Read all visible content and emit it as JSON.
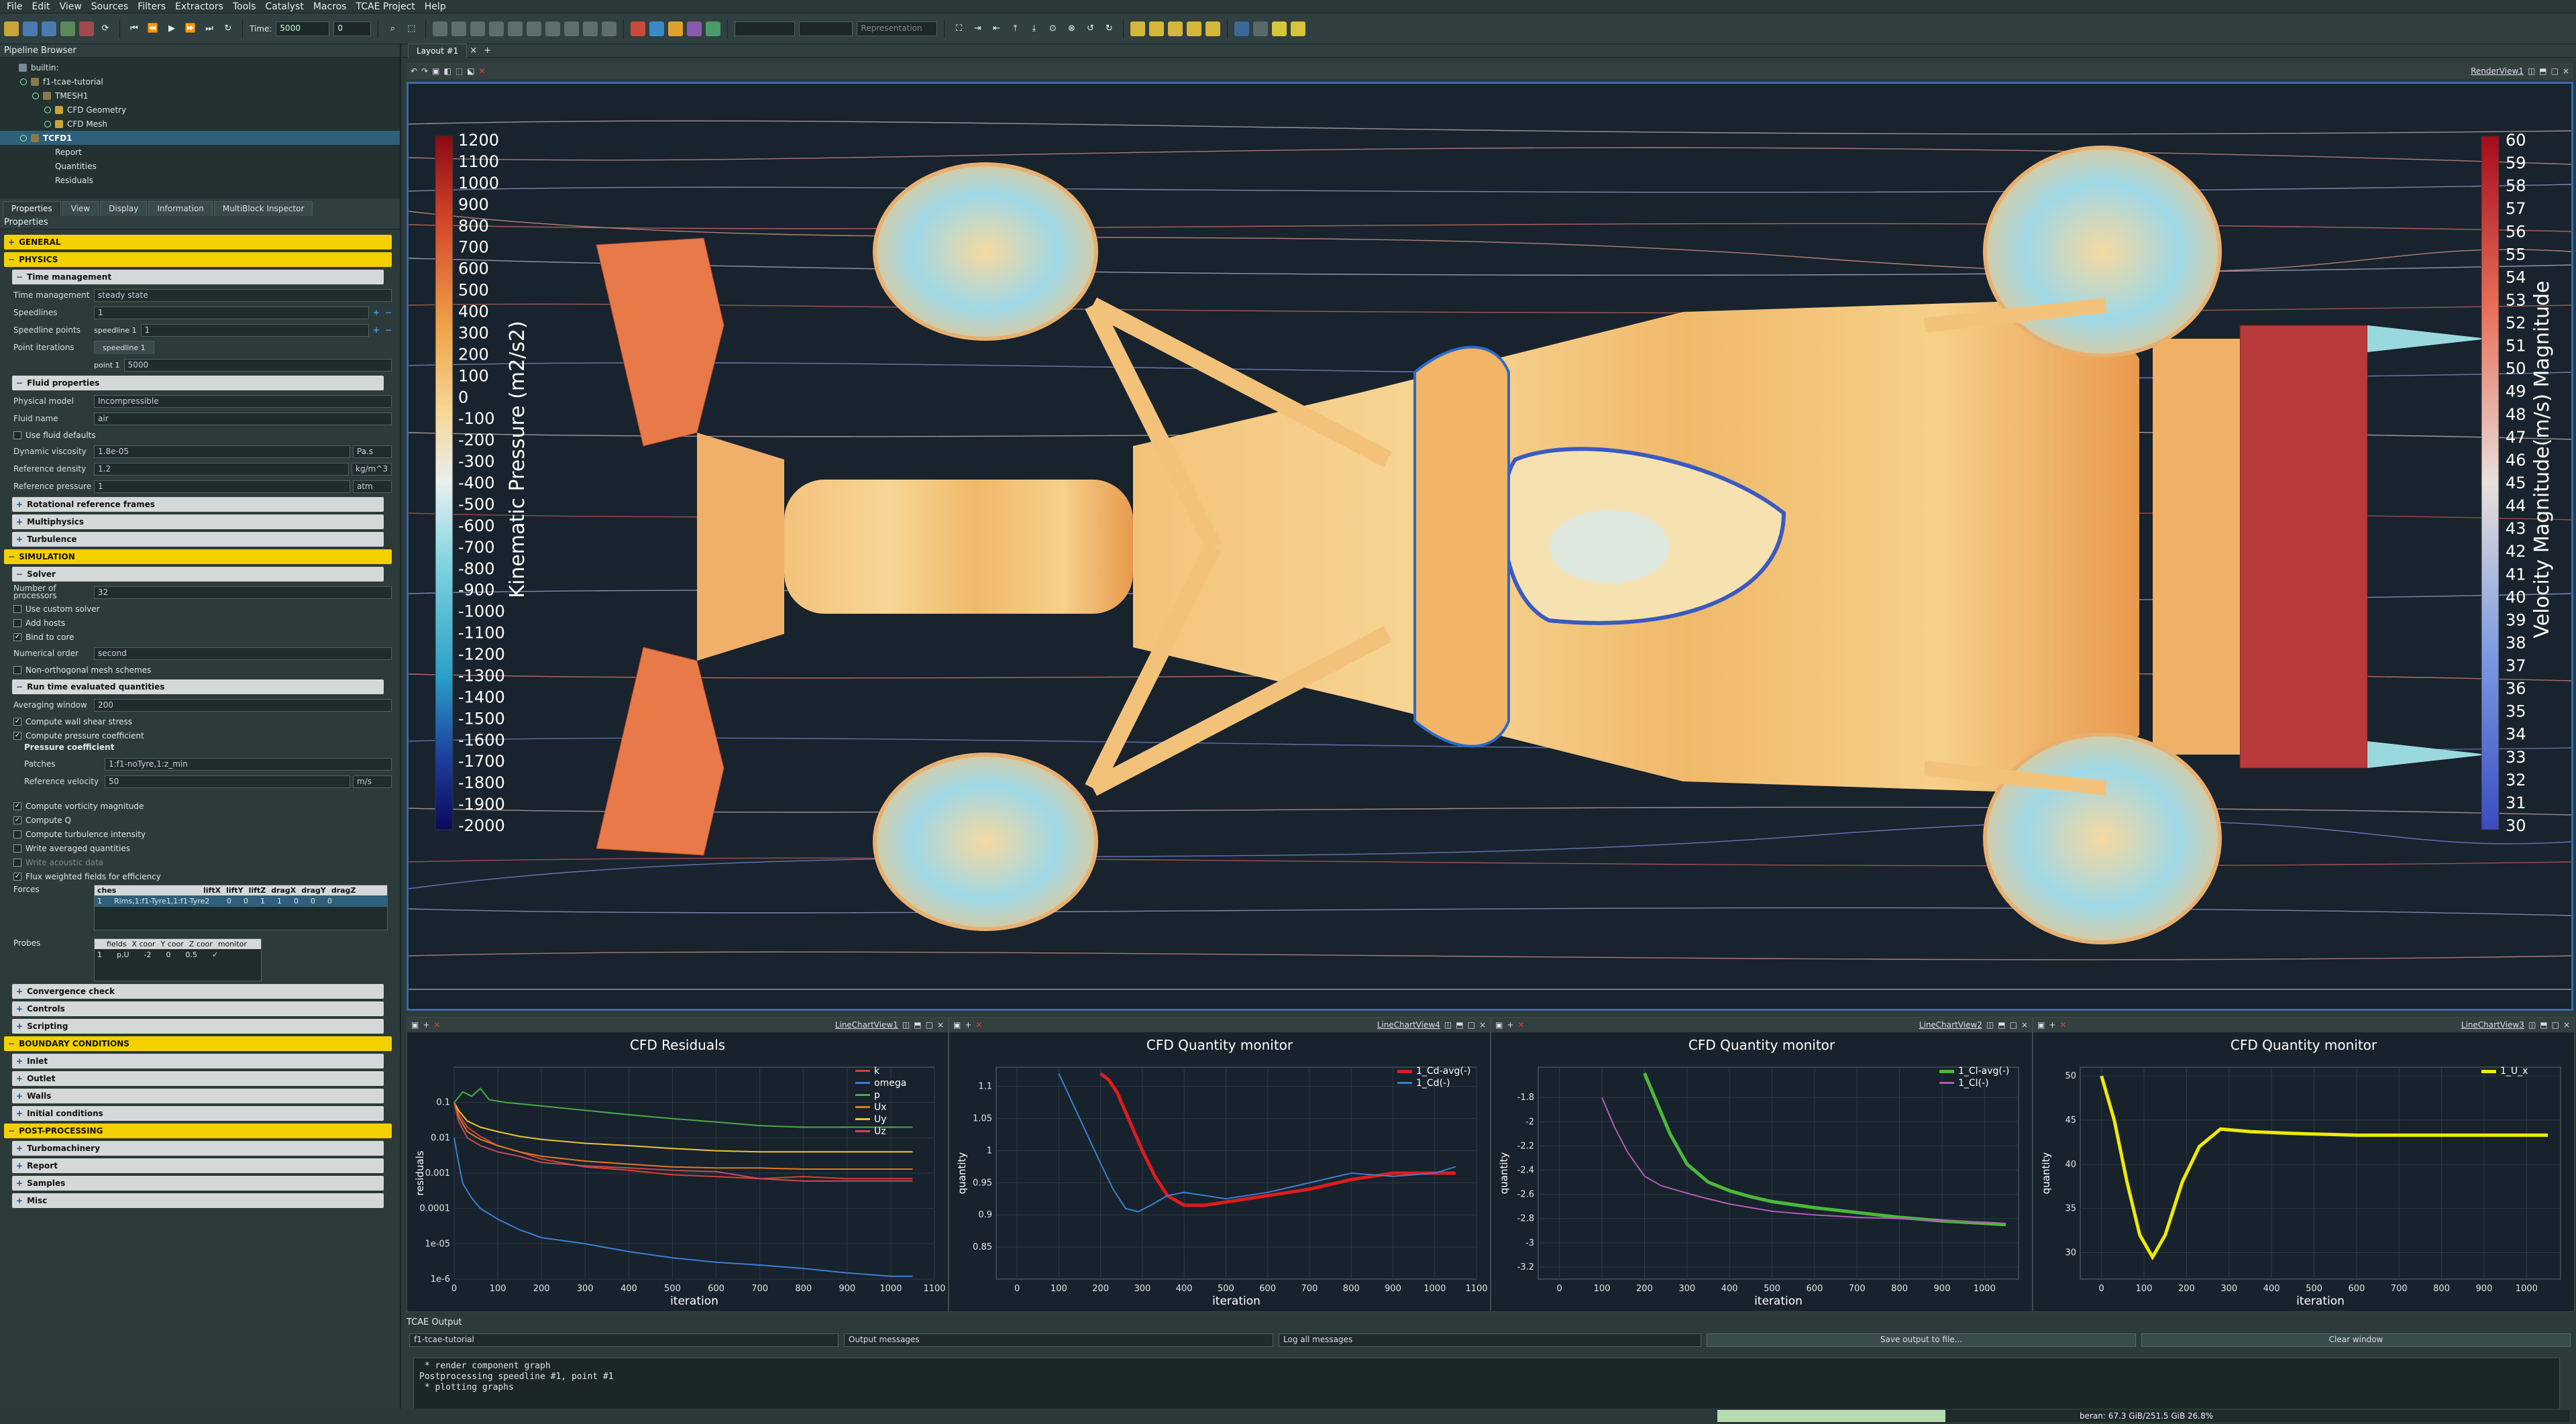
{
  "menu": [
    "File",
    "Edit",
    "View",
    "Sources",
    "Filters",
    "Extractors",
    "Tools",
    "Catalyst",
    "Macros",
    "TCAE Project",
    "Help"
  ],
  "toolbar": {
    "time_label": "Time:",
    "time_value": "5000",
    "time_index": "0",
    "representation": "Representation"
  },
  "pipeline": {
    "title": "Pipeline Browser",
    "items": [
      "builtin:",
      "f1-tcae-tutorial",
      "TMESH1",
      "CFD Geometry",
      "CFD Mesh",
      "TCFD1",
      "Report",
      "Quantities",
      "Residuals"
    ]
  },
  "tabs": [
    "Properties",
    "View",
    "Display",
    "Information",
    "MultiBlock Inspector"
  ],
  "props_title": "Properties",
  "sections": {
    "general": "GENERAL",
    "physics": "PHYSICS",
    "simulation": "SIMULATION",
    "boundary": "BOUNDARY CONDITIONS",
    "post": "POST-PROCESSING"
  },
  "time_mgmt": {
    "title": "Time management",
    "label": "Time management",
    "value": "steady state",
    "speedlines_label": "Speedlines",
    "speedlines_value": "1",
    "points_label": "Speedline points",
    "points_sub": "speedline 1",
    "points_value": "1",
    "iter_label": "Point iterations",
    "iter_tab": "speedline 1",
    "iter_point": "point 1",
    "iter_value": "5000"
  },
  "fluid": {
    "title": "Fluid properties",
    "model_label": "Physical model",
    "model_value": "Incompressible",
    "name_label": "Fluid name",
    "name_value": "air",
    "defaults": "Use fluid defaults",
    "visc_label": "Dynamic viscosity",
    "visc_value": "1.8e-05",
    "visc_unit": "Pa.s",
    "dens_label": "Reference density",
    "dens_value": "1.2",
    "dens_unit": "kg/m^3",
    "pres_label": "Reference pressure",
    "pres_value": "1",
    "pres_unit": "atm"
  },
  "collapsed_phys": [
    "Rotational reference frames",
    "Multiphysics",
    "Turbulence"
  ],
  "solver": {
    "title": "Solver",
    "nproc_label": "Number of processors",
    "nproc_value": "32",
    "custom": "Use custom solver",
    "hosts": "Add hosts",
    "bind": "Bind to core",
    "order_label": "Numerical order",
    "order_value": "second",
    "nonortho": "Non-orthogonal mesh schemes"
  },
  "runtime": {
    "title": "Run time evaluated quantities",
    "avg_label": "Averaging window",
    "avg_value": "200",
    "wss": "Compute wall shear stress",
    "cp": "Compute pressure coefficient",
    "cp_title": "Pressure coefficient",
    "patches_label": "Patches",
    "patches_value": "1:f1-noTyre,1:z_min",
    "vel_label": "Reference velocity",
    "vel_value": "50",
    "vel_unit": "m/s",
    "vort": "Compute vorticity magnitude",
    "q": "Compute Q",
    "ti": "Compute turbulence intensity",
    "avgq": "Write averaged quantities",
    "acoustic": "Write acoustic data",
    "flux": "Flux weighted fields for efficiency",
    "forces_label": "Forces",
    "forces_headers": [
      "ches",
      "liftX",
      "liftY",
      "liftZ",
      "dragX",
      "dragY",
      "dragZ"
    ],
    "forces_row": [
      "1",
      "Rims,1:f1-Tyre1,1:f1-Tyre2",
      "0",
      "0",
      "1",
      "1",
      "0",
      "0",
      "0"
    ],
    "probes_label": "Probes",
    "probes_headers": [
      "fields",
      "X coor",
      "Y coor",
      "Z coor",
      "monitor"
    ],
    "probes_row": [
      "1",
      "p,U",
      "-2",
      "0",
      "0.5",
      "✓"
    ]
  },
  "collapsed_sim": [
    "Convergence check",
    "Controls",
    "Scripting"
  ],
  "collapsed_bc": [
    "Inlet",
    "Outlet",
    "Walls",
    "Initial conditions"
  ],
  "collapsed_post": [
    "Turbomachinery",
    "Report",
    "Samples",
    "Misc"
  ],
  "layout_tab": "Layout #1",
  "render_view": "RenderView1",
  "colorbar_left": {
    "title": "Kinematic Pressure (m2/s2)",
    "ticks": [
      "1200",
      "1100",
      "1000",
      "900",
      "800",
      "700",
      "600",
      "500",
      "400",
      "300",
      "200",
      "100",
      "0",
      "-100",
      "-200",
      "-300",
      "-400",
      "-500",
      "-600",
      "-700",
      "-800",
      "-900",
      "-1000",
      "-1100",
      "-1200",
      "-1300",
      "-1400",
      "-1500",
      "-1600",
      "-1700",
      "-1800",
      "-1900",
      "-2000"
    ]
  },
  "colorbar_right": {
    "title": "Velocity Magnitude(m/s) Magnitude",
    "ticks": [
      "60",
      "59",
      "58",
      "57",
      "56",
      "55",
      "54",
      "53",
      "52",
      "51",
      "50",
      "49",
      "48",
      "47",
      "46",
      "45",
      "44",
      "43",
      "42",
      "41",
      "40",
      "39",
      "38",
      "37",
      "36",
      "35",
      "34",
      "33",
      "32",
      "31",
      "30"
    ]
  },
  "colors": {
    "accent_yellow": "#f5d000",
    "render_border": "#3a6aa8",
    "cd_avg": "#dd1c1c",
    "cl_avg": "#4cb83a",
    "u_x": "#f0ea00"
  },
  "chart_data": [
    {
      "view": "LineChartView1",
      "type": "line",
      "title": "CFD Residuals",
      "xlabel": "iteration",
      "ylabel": "residuals",
      "ylog": true,
      "xlim": [
        0,
        1100
      ],
      "ylim": [
        1e-06,
        1
      ],
      "xticks": [
        "0",
        "100",
        "200",
        "300",
        "400",
        "500",
        "600",
        "700",
        "800",
        "900",
        "1000",
        "1100"
      ],
      "yticks": [
        "0.1",
        "0.01",
        "0.001",
        "0.0001",
        "1e-05",
        "1e-6"
      ],
      "legend": "top-right",
      "series": [
        {
          "name": "k",
          "color": "#d4432a",
          "x": [
            0,
            10,
            30,
            60,
            100,
            150,
            200,
            300,
            400,
            500,
            600,
            700,
            800,
            900,
            1000,
            1050
          ],
          "y": [
            0.1,
            0.05,
            0.02,
            0.011,
            0.006,
            0.004,
            0.0025,
            0.0015,
            0.0012,
            0.0009,
            0.0008,
            0.0007,
            0.0008,
            0.0007,
            0.0007,
            0.0007
          ]
        },
        {
          "name": "omega",
          "color": "#3a7fd0",
          "x": [
            0,
            10,
            20,
            40,
            60,
            100,
            150,
            200,
            300,
            400,
            500,
            600,
            700,
            800,
            900,
            1000,
            1050
          ],
          "y": [
            0.01,
            0.002,
            0.0005,
            0.0002,
            0.0001,
            5e-05,
            2.5e-05,
            1.5e-05,
            1e-05,
            6e-06,
            4e-06,
            3e-06,
            2.5e-06,
            2e-06,
            1.5e-06,
            1.2e-06,
            1.2e-06
          ]
        },
        {
          "name": "p",
          "color": "#4caa46",
          "x": [
            0,
            20,
            40,
            60,
            80,
            120,
            200,
            300,
            400,
            500,
            600,
            700,
            800,
            900,
            1000,
            1050
          ],
          "y": [
            0.1,
            0.2,
            0.15,
            0.25,
            0.12,
            0.1,
            0.08,
            0.06,
            0.045,
            0.035,
            0.028,
            0.022,
            0.02,
            0.02,
            0.02,
            0.02
          ]
        },
        {
          "name": "Ux",
          "color": "#e07a20",
          "x": [
            0,
            10,
            30,
            60,
            100,
            150,
            200,
            300,
            400,
            500,
            600,
            700,
            800,
            900,
            1000,
            1050
          ],
          "y": [
            0.1,
            0.04,
            0.015,
            0.009,
            0.006,
            0.004,
            0.003,
            0.0022,
            0.0018,
            0.0015,
            0.0014,
            0.0014,
            0.0013,
            0.0013,
            0.0013,
            0.0013
          ]
        },
        {
          "name": "Uy",
          "color": "#f2c22e",
          "x": [
            0,
            10,
            30,
            60,
            100,
            150,
            200,
            300,
            400,
            500,
            600,
            700,
            800,
            900,
            1000,
            1050
          ],
          "y": [
            0.1,
            0.06,
            0.03,
            0.02,
            0.015,
            0.011,
            0.009,
            0.007,
            0.006,
            0.005,
            0.0043,
            0.004,
            0.004,
            0.004,
            0.004,
            0.004
          ]
        },
        {
          "name": "Uz",
          "color": "#c64a5a",
          "x": [
            0,
            10,
            30,
            60,
            100,
            150,
            200,
            300,
            400,
            500,
            600,
            700,
            800,
            900,
            1000,
            1050
          ],
          "y": [
            0.1,
            0.03,
            0.01,
            0.006,
            0.004,
            0.003,
            0.002,
            0.0016,
            0.0014,
            0.0012,
            0.0011,
            0.0007,
            0.0006,
            0.0006,
            0.0006,
            0.0006
          ]
        }
      ]
    },
    {
      "view": "LineChartView4",
      "type": "line",
      "title": "CFD Quantity monitor",
      "xlabel": "iteration",
      "ylabel": "quantity",
      "xlim": [
        -50,
        1100
      ],
      "ylim": [
        0.8,
        1.13
      ],
      "xticks": [
        "0",
        "100",
        "200",
        "300",
        "400",
        "500",
        "600",
        "700",
        "800",
        "900",
        "1000",
        "1100"
      ],
      "yticks": [
        "1.1",
        "1.05",
        "1",
        "0.95",
        "0.9",
        "0.85"
      ],
      "legend": "top-right",
      "series": [
        {
          "name": "1_Cd-avg(-)",
          "color": "#dd1c1c",
          "x": [
            200,
            220,
            240,
            260,
            280,
            300,
            330,
            360,
            400,
            450,
            500,
            600,
            700,
            800,
            900,
            1000,
            1050
          ],
          "y": [
            1.12,
            1.11,
            1.09,
            1.06,
            1.03,
            1.0,
            0.96,
            0.93,
            0.915,
            0.915,
            0.92,
            0.93,
            0.94,
            0.955,
            0.965,
            0.965,
            0.965
          ]
        },
        {
          "name": "1_Cd(-)",
          "color": "#3a7fd0",
          "x": [
            100,
            150,
            200,
            230,
            260,
            290,
            320,
            360,
            400,
            450,
            500,
            600,
            700,
            800,
            900,
            1000,
            1050
          ],
          "y": [
            1.12,
            1.05,
            0.98,
            0.94,
            0.91,
            0.905,
            0.915,
            0.93,
            0.935,
            0.93,
            0.925,
            0.935,
            0.95,
            0.965,
            0.96,
            0.965,
            0.975
          ]
        }
      ]
    },
    {
      "view": "LineChartView2",
      "type": "line",
      "title": "CFD Quantity monitor",
      "xlabel": "iteration",
      "ylabel": "quantity",
      "xlim": [
        -50,
        1080
      ],
      "ylim": [
        -3.3,
        -1.55
      ],
      "xticks": [
        "0",
        "100",
        "200",
        "300",
        "400",
        "500",
        "600",
        "700",
        "800",
        "900",
        "1000"
      ],
      "yticks": [
        "-1.8",
        "-2",
        "-2.2",
        "-2.4",
        "-2.6",
        "-2.8",
        "-3",
        "-3.2"
      ],
      "legend": "top-right",
      "series": [
        {
          "name": "1_Cl-avg(-)",
          "color": "#4cb83a",
          "x": [
            200,
            230,
            260,
            300,
            350,
            400,
            450,
            500,
            600,
            700,
            800,
            900,
            1000,
            1050
          ],
          "y": [
            -1.6,
            -1.85,
            -2.1,
            -2.35,
            -2.5,
            -2.57,
            -2.62,
            -2.66,
            -2.71,
            -2.75,
            -2.79,
            -2.82,
            -2.84,
            -2.85
          ]
        },
        {
          "name": "1_Cl(-)",
          "color": "#b45cb4",
          "x": [
            100,
            130,
            160,
            200,
            240,
            280,
            330,
            400,
            500,
            600,
            700,
            800,
            900,
            1000,
            1050
          ],
          "y": [
            -1.8,
            -2.05,
            -2.25,
            -2.45,
            -2.53,
            -2.57,
            -2.62,
            -2.68,
            -2.74,
            -2.77,
            -2.79,
            -2.8,
            -2.82,
            -2.83,
            -2.84
          ]
        }
      ]
    },
    {
      "view": "LineChartView3",
      "type": "line",
      "title": "CFD Quantity monitor",
      "xlabel": "iteration",
      "ylabel": "quantity",
      "xlim": [
        -50,
        1080
      ],
      "ylim": [
        27,
        51
      ],
      "xticks": [
        "0",
        "100",
        "200",
        "300",
        "400",
        "500",
        "600",
        "700",
        "800",
        "900",
        "1000"
      ],
      "yticks": [
        "50",
        "45",
        "40",
        "35",
        "30"
      ],
      "legend": "top-right",
      "series": [
        {
          "name": "1_U_x",
          "color": "#f0ea00",
          "x": [
            0,
            30,
            60,
            90,
            120,
            150,
            190,
            230,
            280,
            350,
            450,
            600,
            800,
            1000,
            1050
          ],
          "y": [
            50,
            45,
            38,
            32,
            29.5,
            32,
            38,
            42,
            44,
            43.7,
            43.5,
            43.3,
            43.3,
            43.3,
            43.3
          ]
        }
      ]
    }
  ],
  "output": {
    "title": "TCAE Output",
    "source": "f1-tcae-tutorial",
    "type": "Output messages",
    "filter": "Log all messages",
    "save": "Save output to file...",
    "clear": "Clear window",
    "lines": [
      " * render component graph",
      "Postprocessing speedline #1, point #1",
      " * plotting graphs"
    ]
  },
  "statusbar": {
    "memory": "beran: 67.3 GiB/251.5 GiB 26.8%",
    "memory_fraction": 0.268
  }
}
